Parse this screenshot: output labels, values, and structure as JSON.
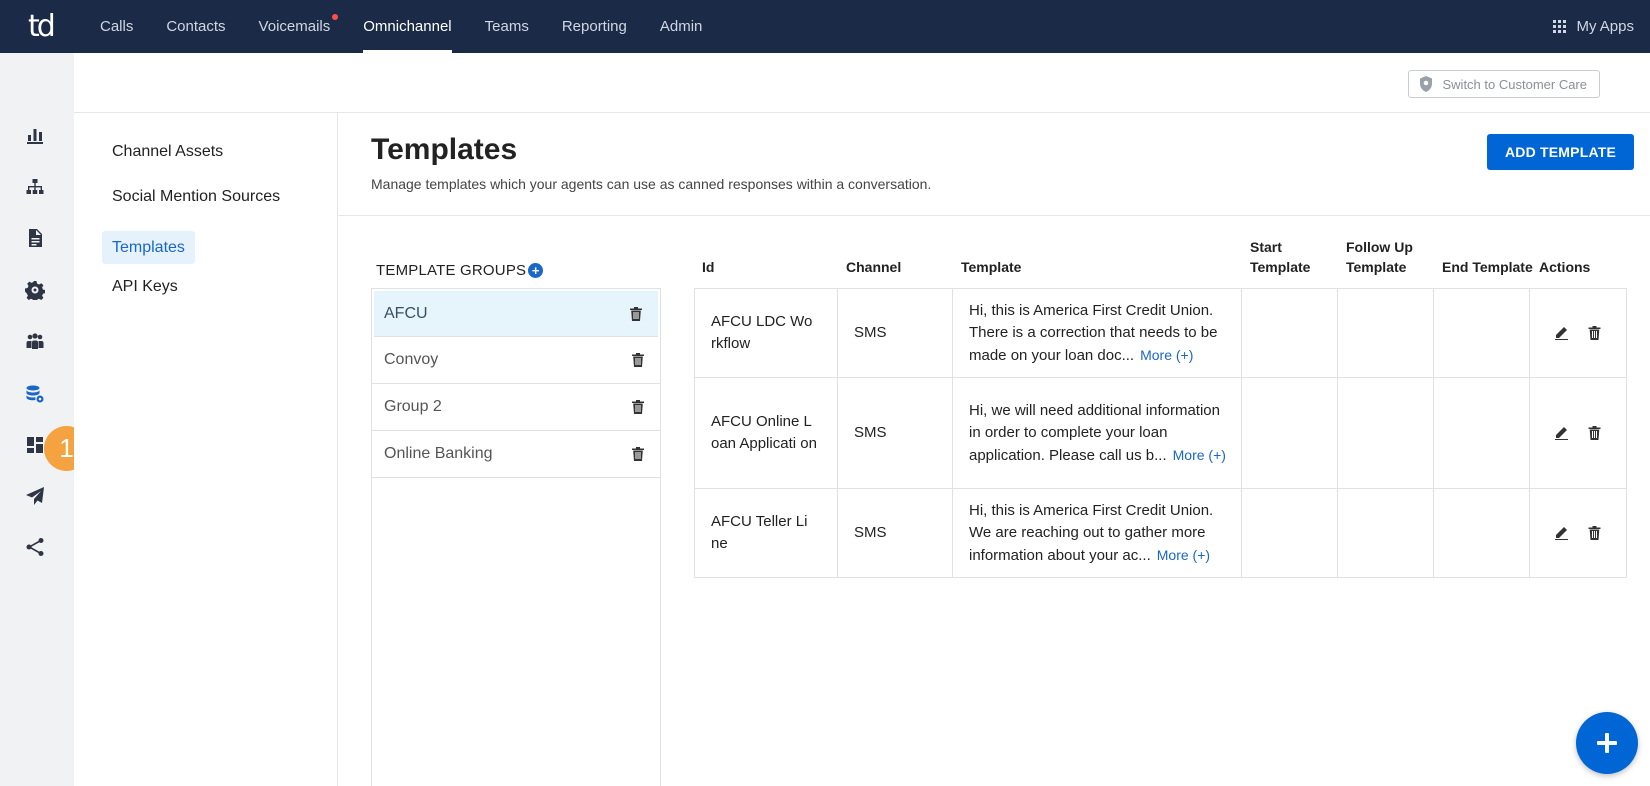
{
  "brand": {
    "logo_text": "td",
    "accent": "#0066d6",
    "nav_bg": "#1b2a47"
  },
  "nav": {
    "items": [
      {
        "label": "Calls",
        "active": false
      },
      {
        "label": "Contacts",
        "active": false
      },
      {
        "label": "Voicemails",
        "active": false,
        "notification": true
      },
      {
        "label": "Omnichannel",
        "active": true
      },
      {
        "label": "Teams",
        "active": false
      },
      {
        "label": "Reporting",
        "active": false
      },
      {
        "label": "Admin",
        "active": false
      }
    ],
    "my_apps": "My Apps"
  },
  "rail": {
    "icons": [
      "bar-chart-icon",
      "hierarchy-icon",
      "document-icon",
      "gear-icon",
      "people-icon",
      "database-gear-icon",
      "dashboard-icon",
      "send-icon",
      "share-icon"
    ],
    "badge": "1"
  },
  "subheader": {
    "switch_label": "Switch to Customer Care"
  },
  "sidemenu": {
    "items": [
      {
        "label": "Channel Assets",
        "active": false
      },
      {
        "label": "Social Mention Sources",
        "active": false
      },
      {
        "label": "Templates",
        "active": true
      },
      {
        "label": "API Keys",
        "active": false
      }
    ]
  },
  "page": {
    "title": "Templates",
    "description": "Manage templates which your agents can use as canned responses within a conversation.",
    "add_button": "ADD TEMPLATE"
  },
  "groups": {
    "title": "TEMPLATE GROUPS",
    "items": [
      {
        "name": "AFCU",
        "active": true
      },
      {
        "name": "Convoy",
        "active": false
      },
      {
        "name": "Group 2",
        "active": false
      },
      {
        "name": "Online Banking",
        "active": false
      }
    ]
  },
  "table": {
    "columns": {
      "id": "Id",
      "channel": "Channel",
      "template": "Template",
      "start_1": "Start",
      "start_2": "Template",
      "follow_1": "Follow Up",
      "follow_2": "Template",
      "end": "End Template",
      "actions": "Actions"
    },
    "more_label": "More (+)",
    "rows": [
      {
        "id": "AFCU LDC Wo rkflow",
        "channel": "SMS",
        "template": "Hi, this is America First Credit Union. There is a correction that needs to be made on your loan doc...",
        "start": "",
        "follow_up": "",
        "end": ""
      },
      {
        "id": "AFCU Online L oan Applicati on",
        "channel": "SMS",
        "template": "Hi, we will need additional information in order to complete your loan application. Please call us b...",
        "start": "",
        "follow_up": "",
        "end": ""
      },
      {
        "id": "AFCU Teller Li ne",
        "channel": "SMS",
        "template": "Hi, this is America First Credit Union. We are reaching out to gather more information about your ac...",
        "start": "",
        "follow_up": "",
        "end": ""
      }
    ]
  }
}
